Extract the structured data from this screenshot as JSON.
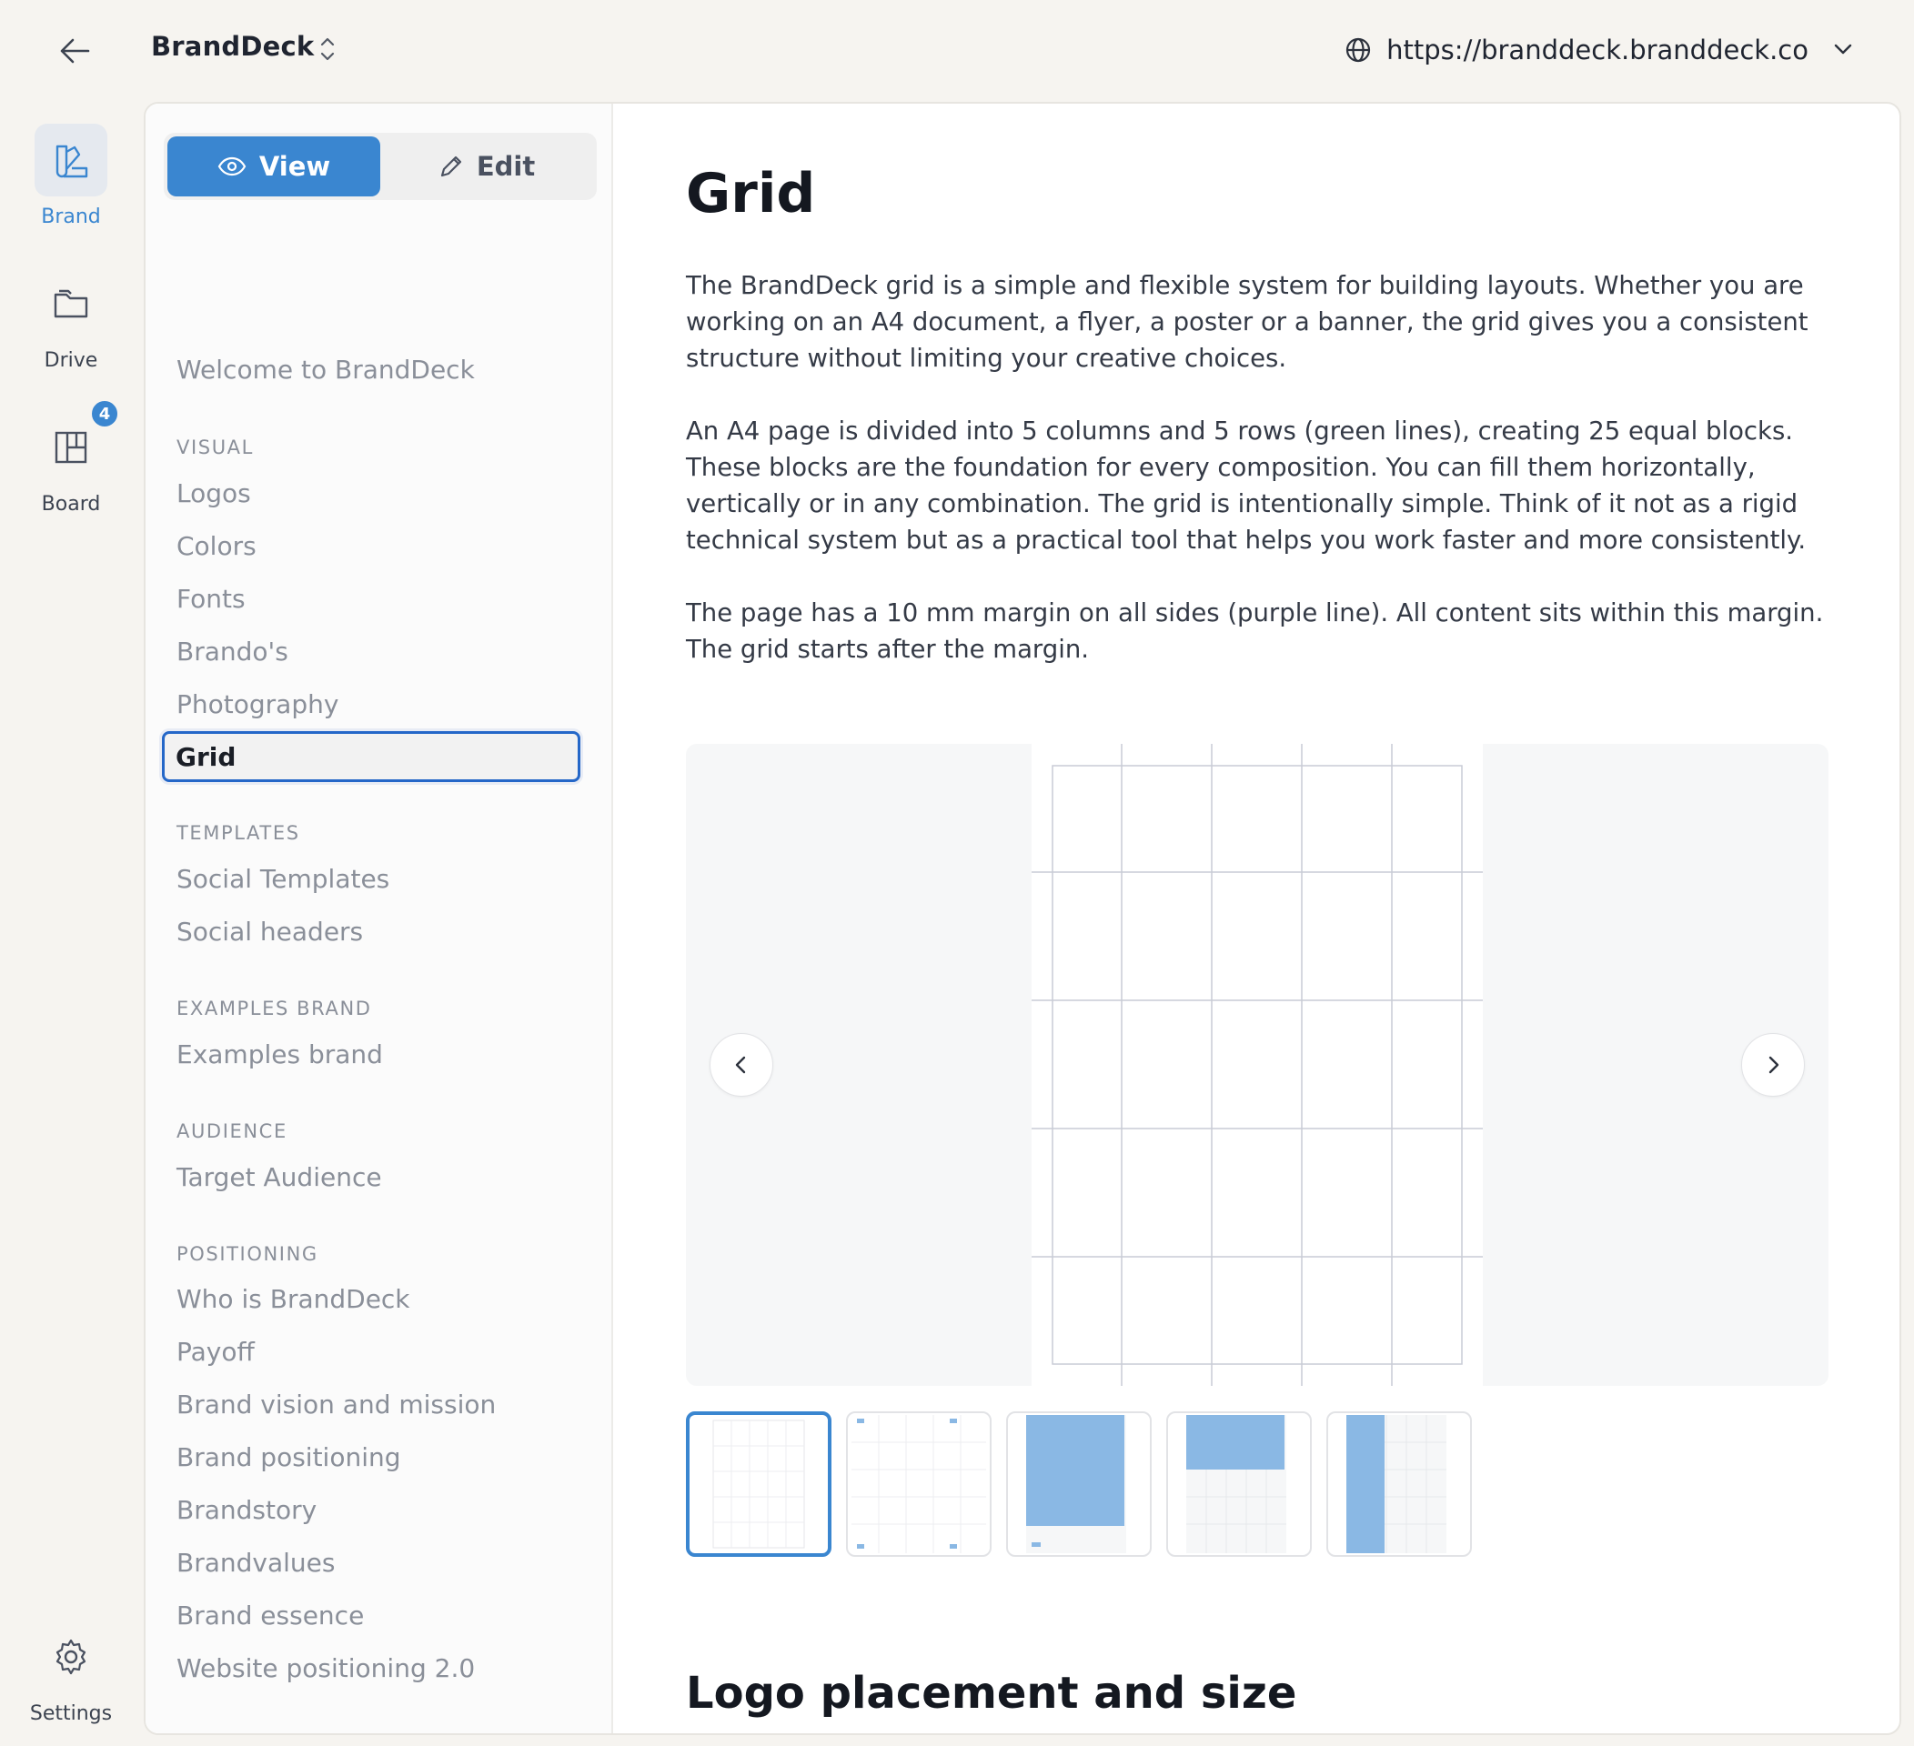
{
  "header": {
    "app_name": "BrandDeck",
    "url": "https://branddeck.branddeck.co"
  },
  "rail": {
    "items": [
      {
        "label": "Brand",
        "icon": "swatch-icon",
        "active": true
      },
      {
        "label": "Drive",
        "icon": "folder-icon"
      },
      {
        "label": "Board",
        "icon": "board-icon",
        "badge": "4"
      }
    ],
    "settings_label": "Settings"
  },
  "toggle": {
    "view_label": "View",
    "edit_label": "Edit"
  },
  "sidebar": {
    "welcome": "Welcome to BrandDeck",
    "sections": [
      {
        "title": "VISUAL",
        "items": [
          "Logos",
          "Colors",
          "Fonts",
          "Brando's",
          "Photography",
          "Grid"
        ]
      },
      {
        "title": "TEMPLATES",
        "items": [
          "Social Templates",
          "Social headers"
        ]
      },
      {
        "title": "EXAMPLES BRAND",
        "items": [
          "Examples brand"
        ]
      },
      {
        "title": "AUDIENCE",
        "items": [
          "Target Audience"
        ]
      },
      {
        "title": "POSITIONING",
        "items": [
          "Who is BrandDeck",
          "Payoff",
          "Brand vision and mission",
          "Brand positioning",
          "Brandstory",
          "Brandvalues",
          "Brand essence",
          "Website positioning 2.0"
        ]
      }
    ],
    "active_item": "Grid"
  },
  "content": {
    "title": "Grid",
    "paragraphs": [
      "The BrandDeck grid is a simple and flexible system for building layouts. Whether you are working on an A4 document, a flyer, a poster or a banner, the grid gives you a consistent structure without limiting your creative choices.",
      "An A4 page is divided into 5 columns and 5 rows (green lines), creating 25 equal blocks. These blocks are the foundation for every composition. You can fill them horizontally, vertically or in any combination. The grid is intentionally simple. Think of it not as a rigid technical system but as a practical tool that helps you work faster and more consistently.",
      "The page has a 10 mm margin on all sides (purple line). All content sits within this margin. The grid starts after the margin."
    ],
    "section2_title": "Logo placement and size"
  },
  "carousel": {
    "active_index": 0,
    "thumbnails": [
      "grid-empty",
      "grid-logo-corners",
      "grid-block-large",
      "grid-block-top",
      "grid-block-vertical"
    ]
  },
  "colors": {
    "accent": "#3a86d0",
    "grid_line": "#c9ccd6",
    "fill_block": "#8ab8e4",
    "background": "#f6f4f0"
  }
}
